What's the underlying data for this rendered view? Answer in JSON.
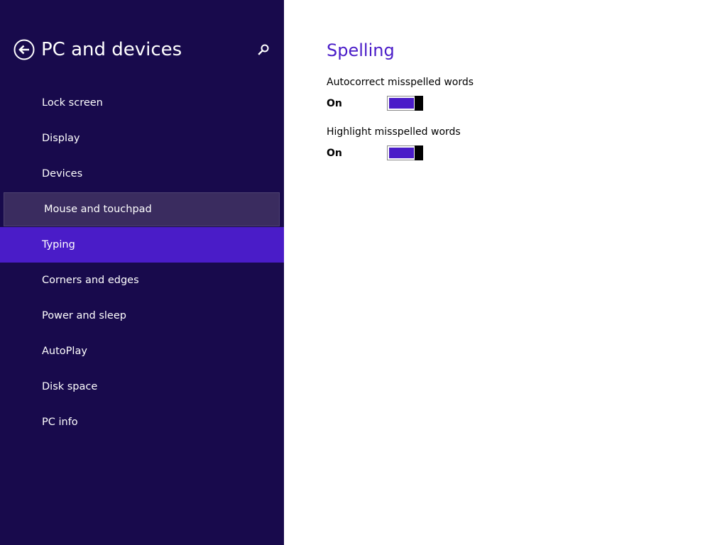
{
  "sidebar": {
    "title": "PC and devices",
    "back_icon": "back-arrow-icon",
    "search_icon": "search-icon",
    "items": [
      {
        "label": "Lock screen",
        "state": "normal"
      },
      {
        "label": "Display",
        "state": "normal"
      },
      {
        "label": "Devices",
        "state": "normal"
      },
      {
        "label": "Mouse and touchpad",
        "state": "hover"
      },
      {
        "label": "Typing",
        "state": "selected"
      },
      {
        "label": "Corners and edges",
        "state": "normal"
      },
      {
        "label": "Power and sleep",
        "state": "normal"
      },
      {
        "label": "AutoPlay",
        "state": "normal"
      },
      {
        "label": "Disk space",
        "state": "normal"
      },
      {
        "label": "PC info",
        "state": "normal"
      }
    ]
  },
  "main": {
    "section_title": "Spelling",
    "settings": [
      {
        "label": "Autocorrect misspelled words",
        "state_label": "On",
        "value": true
      },
      {
        "label": "Highlight misspelled words",
        "state_label": "On",
        "value": true
      }
    ]
  },
  "colors": {
    "sidebar_bg": "#180a4c",
    "accent": "#4a1cc8",
    "hover_bg": "#3a2c5f",
    "content_bg": "#ffffff"
  }
}
